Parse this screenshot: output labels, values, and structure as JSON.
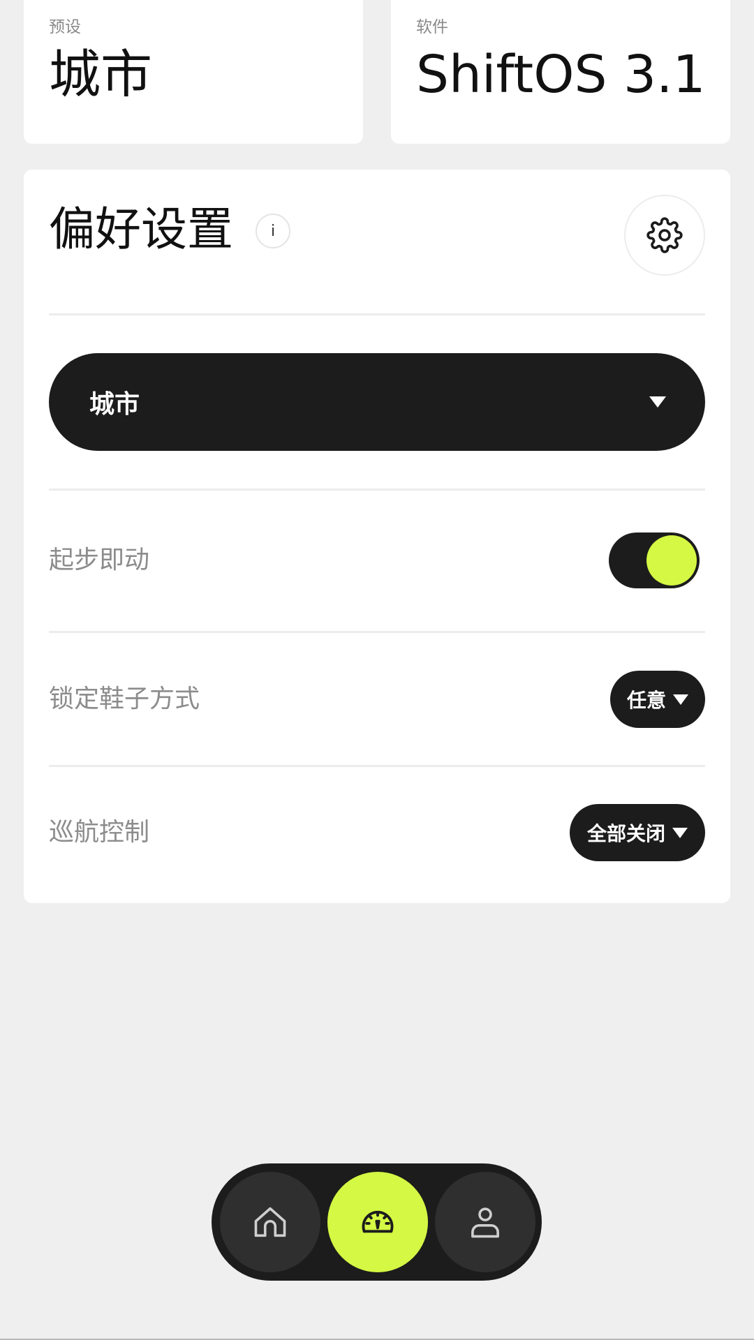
{
  "top_cards": {
    "preset_label": "预设",
    "preset_value": "城市",
    "software_label": "软件",
    "software_value": "ShiftOS 3.1"
  },
  "preferences": {
    "title": "偏好设置",
    "info_glyph": "i",
    "settings_icon": "gear-icon",
    "mode_select": {
      "selected": "城市"
    },
    "rows": [
      {
        "label": "起步即动",
        "control": "toggle",
        "enabled": true
      },
      {
        "label": "锁定鞋子方式",
        "control": "select",
        "selected": "任意"
      },
      {
        "label": "巡航控制",
        "control": "select",
        "selected": "全部关闭"
      }
    ]
  },
  "bottom_nav": {
    "items": [
      {
        "icon": "home-icon",
        "active": false
      },
      {
        "icon": "speedometer-icon",
        "active": true
      },
      {
        "icon": "user-icon",
        "active": false
      }
    ]
  },
  "colors": {
    "accent": "#d4f843",
    "dark": "#1c1c1c",
    "background": "#efefef",
    "card": "#ffffff",
    "muted_text": "#8c8c8c"
  }
}
